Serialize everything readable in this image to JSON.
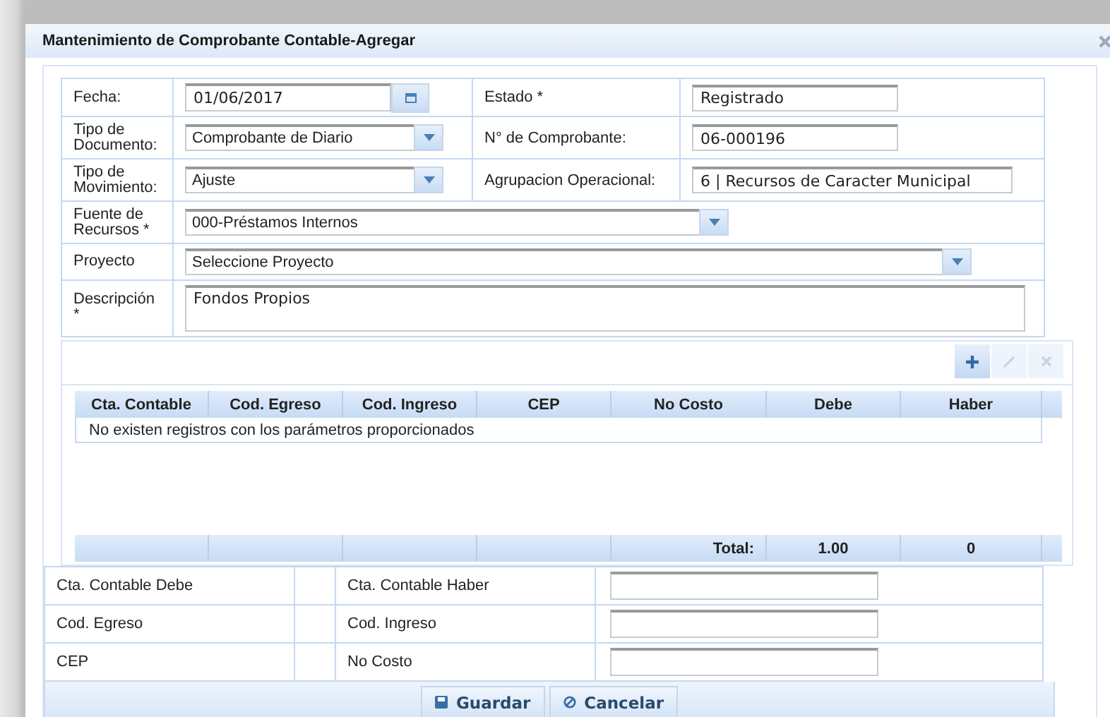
{
  "window": {
    "title": "Mantenimiento de Comprobante Contable-Agregar"
  },
  "form_rows": [
    [
      {
        "label": "Fecha:",
        "kind": "date",
        "value": "01/06/2017"
      },
      {
        "label": "Estado *",
        "kind": "text",
        "value": "Registrado"
      }
    ],
    [
      {
        "label": "Tipo de Documento:",
        "kind": "select",
        "value": "Comprobante de Diario"
      },
      {
        "label": "N° de Comprobante:",
        "kind": "text",
        "value": "06-000196"
      }
    ],
    [
      {
        "label": "Tipo de Movimiento:",
        "kind": "select",
        "value": "Ajuste"
      },
      {
        "label": "Agrupacion Operacional:",
        "kind": "widetext",
        "value": "6 | Recursos de Caracter Municipal"
      }
    ],
    [
      {
        "label": "Fuente de Recursos *",
        "kind": "select",
        "value": "000-Préstamos Internos"
      }
    ],
    [
      {
        "label": "Proyecto",
        "kind": "longselect",
        "value": "Seleccione Proyecto"
      }
    ],
    [
      {
        "label": "Descripción *",
        "kind": "textarea",
        "value": "Fondos Propios"
      }
    ]
  ],
  "grid": {
    "tools": [
      {
        "kind": "add",
        "disabled": false
      },
      {
        "kind": "edit",
        "disabled": true
      },
      {
        "kind": "delete",
        "disabled": true
      }
    ],
    "columns": [
      "Cta. Contable",
      "Cod. Egreso",
      "Cod. Ingreso",
      "CEP",
      "No Costo",
      "Debe",
      "Haber"
    ],
    "empty_message": "No existen registros con los parámetros proporcionados",
    "footer": {
      "label": "Total:",
      "debe": "1.00",
      "haber": "0"
    }
  },
  "detail_rows": [
    {
      "left": "Cta. Contable Debe",
      "right": "Cta. Contable Haber"
    },
    {
      "left": "Cod. Egreso",
      "right": "Cod. Ingreso"
    },
    {
      "left": "CEP",
      "right": "No Costo"
    }
  ],
  "buttons": [
    {
      "kind": "save",
      "label": "Guardar"
    },
    {
      "kind": "cancel",
      "label": "Cancelar"
    }
  ]
}
